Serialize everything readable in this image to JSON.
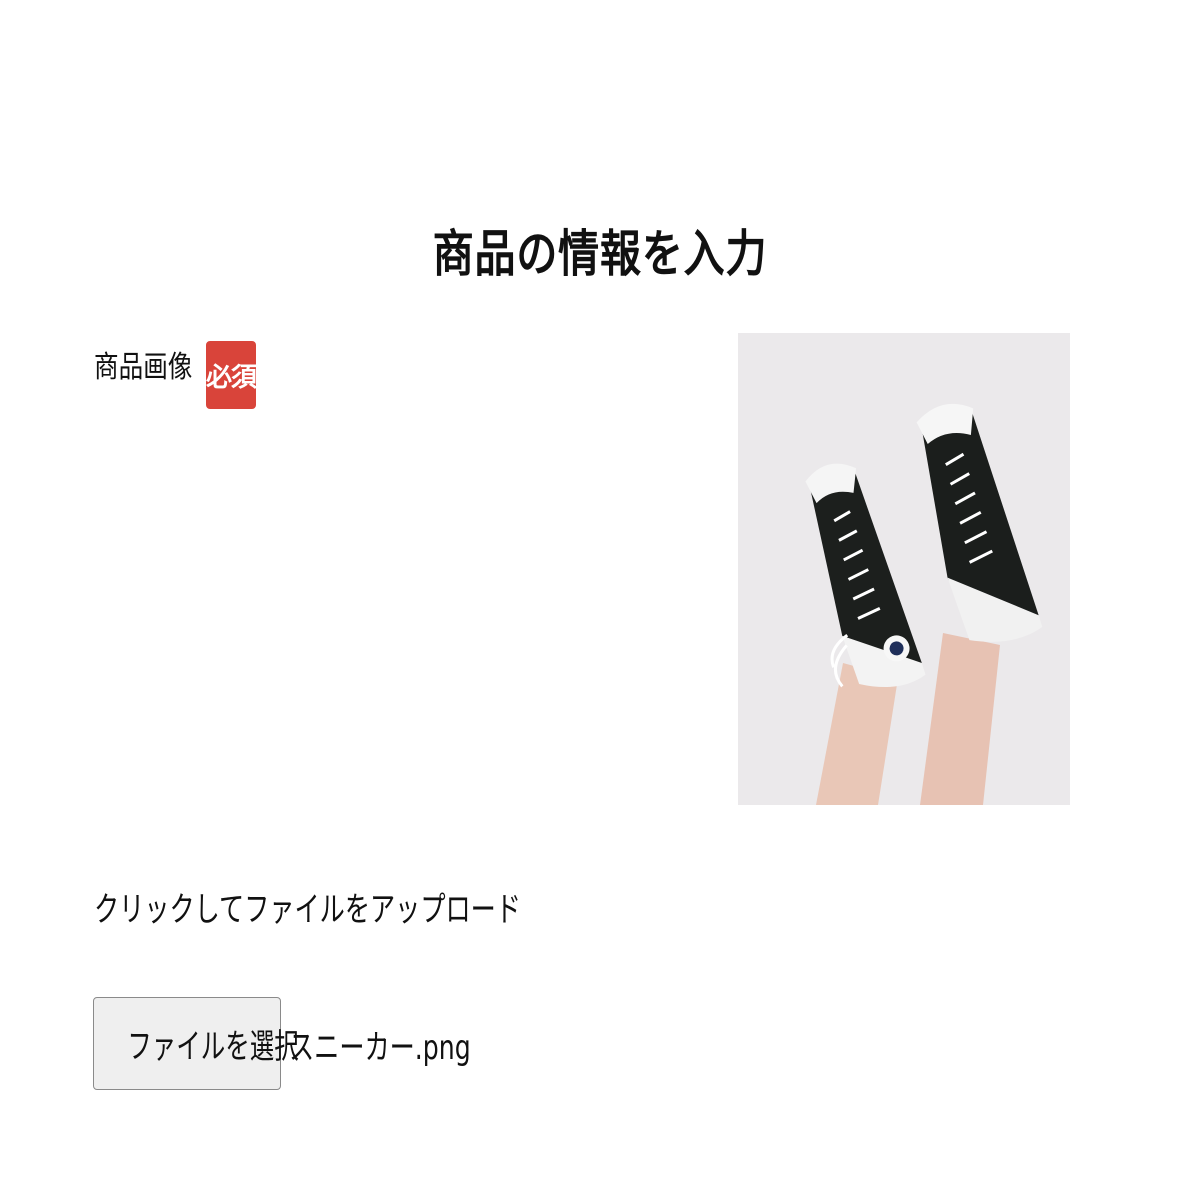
{
  "page": {
    "title": "商品の情報を入力"
  },
  "image_field": {
    "label": "商品画像",
    "required_badge": "必須",
    "upload_hint": "クリックしてファイルをアップロード",
    "file_button_label": "ファイルを選択",
    "selected_file": "スニーカー.png",
    "preview_icon": "sneakers-photo"
  },
  "colors": {
    "required_badge_bg": "#d9443a",
    "preview_bg": "#eceaec"
  }
}
